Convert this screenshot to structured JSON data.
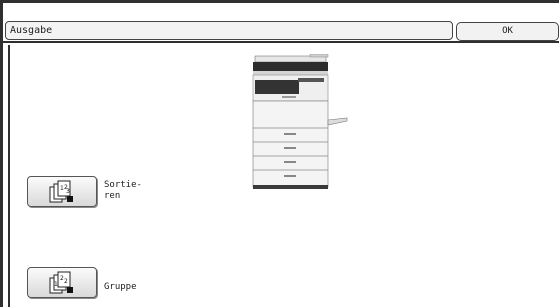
{
  "header": {
    "title": "Ausgabe",
    "ok_label": "OK"
  },
  "options": {
    "sort_label_line1": "Sortie-",
    "sort_label_line2": "ren",
    "group_label": "Gruppe"
  },
  "icons": {
    "sort": "sort-collate-icon",
    "group": "group-stack-icon",
    "device": "copier-illustration"
  },
  "colors": {
    "frame": "#2f2f2f",
    "field_bg": "#f3f3f3"
  }
}
